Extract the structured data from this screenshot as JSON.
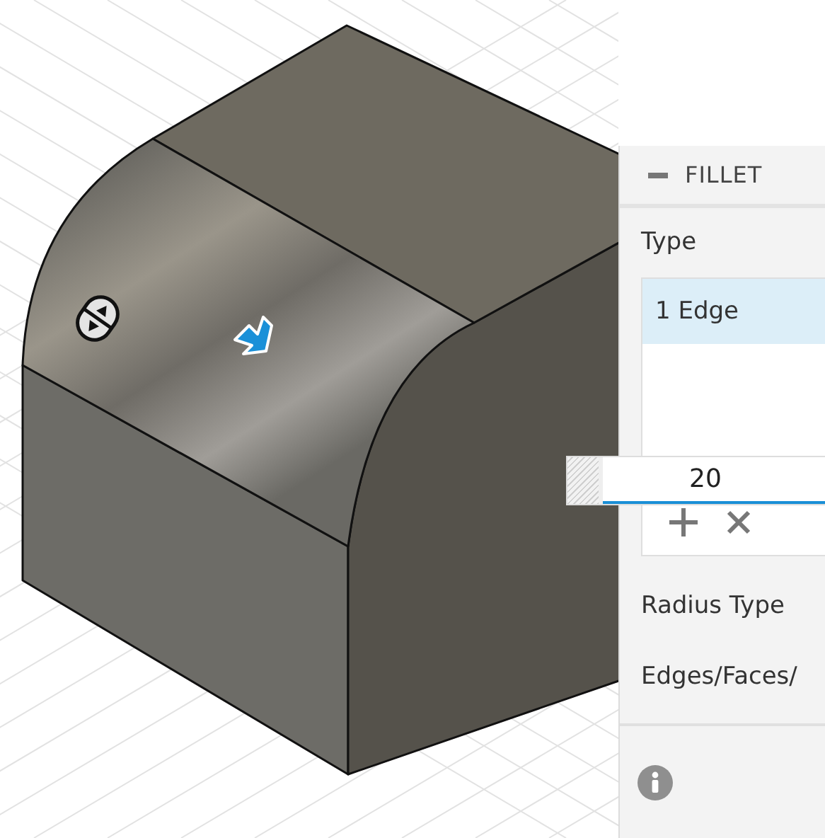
{
  "panel": {
    "title": "FILLET",
    "expanded": true,
    "type_label": "Type",
    "selection": [
      {
        "label": "1 Edge",
        "selected": true
      }
    ],
    "value": "20",
    "radius_type_label": "Radius Type",
    "edges_label": "Edges/Faces/"
  }
}
